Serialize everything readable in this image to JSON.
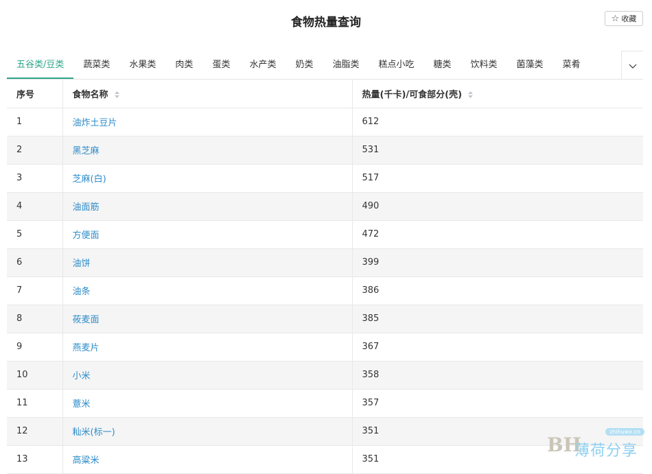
{
  "page": {
    "title": "食物热量查询",
    "favorite_label": "收藏"
  },
  "tabs": [
    {
      "label": "五谷类/豆类",
      "active": true
    },
    {
      "label": "蔬菜类",
      "active": false
    },
    {
      "label": "水果类",
      "active": false
    },
    {
      "label": "肉类",
      "active": false
    },
    {
      "label": "蛋类",
      "active": false
    },
    {
      "label": "水产类",
      "active": false
    },
    {
      "label": "奶类",
      "active": false
    },
    {
      "label": "油脂类",
      "active": false
    },
    {
      "label": "糕点小吃",
      "active": false
    },
    {
      "label": "糖类",
      "active": false
    },
    {
      "label": "饮料类",
      "active": false
    },
    {
      "label": "菌藻类",
      "active": false
    },
    {
      "label": "菜肴",
      "active": false
    }
  ],
  "table": {
    "headers": {
      "index": "序号",
      "name": "食物名称",
      "calories": "热量(千卡)/可食部分(壳)"
    },
    "rows": [
      {
        "index": "1",
        "name": "油炸土豆片",
        "calories": "612"
      },
      {
        "index": "2",
        "name": "黑芝麻",
        "calories": "531"
      },
      {
        "index": "3",
        "name": "芝麻(白)",
        "calories": "517"
      },
      {
        "index": "4",
        "name": "油面筋",
        "calories": "490"
      },
      {
        "index": "5",
        "name": "方便面",
        "calories": "472"
      },
      {
        "index": "6",
        "name": "油饼",
        "calories": "399"
      },
      {
        "index": "7",
        "name": "油条",
        "calories": "386"
      },
      {
        "index": "8",
        "name": "莜麦面",
        "calories": "385"
      },
      {
        "index": "9",
        "name": "燕麦片",
        "calories": "367"
      },
      {
        "index": "10",
        "name": "小米",
        "calories": "358"
      },
      {
        "index": "11",
        "name": "薏米",
        "calories": "357"
      },
      {
        "index": "12",
        "name": "籼米(标一)",
        "calories": "351"
      },
      {
        "index": "13",
        "name": "高粱米",
        "calories": "351"
      }
    ]
  },
  "watermark": {
    "badge": "zhihuwx.cn",
    "logo": "BH",
    "text": "薄荷分享"
  },
  "colors": {
    "accent": "#2ba58a",
    "link": "#2d8cc9",
    "stripe": "#f5f5f5"
  }
}
